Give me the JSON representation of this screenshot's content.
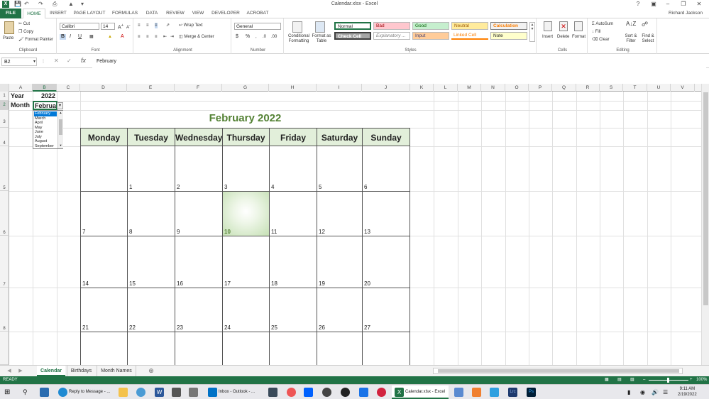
{
  "window": {
    "title": "Calendar.xlsx - Excel",
    "user": "Richard Jackson"
  },
  "colors": {
    "excel_green": "#217346",
    "header_fill": "#e2efda",
    "title_green": "#548235",
    "highlight": "#70ad47"
  },
  "ribbon_tabs": [
    "FILE",
    "HOME",
    "INSERT",
    "PAGE LAYOUT",
    "FORMULAS",
    "DATA",
    "REVIEW",
    "VIEW",
    "DEVELOPER",
    "ACROBAT"
  ],
  "ribbon": {
    "clipboard": {
      "paste": "Paste",
      "cut": "Cut",
      "copy": "Copy",
      "format_painter": "Format Painter",
      "label": "Clipboard"
    },
    "font": {
      "name": "Calibri",
      "size": "14",
      "label": "Font"
    },
    "alignment": {
      "wrap_text": "Wrap Text",
      "merge_center": "Merge & Center",
      "label": "Alignment"
    },
    "number": {
      "format": "General",
      "label": "Number"
    },
    "styles": {
      "conditional": "Conditional Formatting",
      "format_table": "Format as Table",
      "label": "Styles",
      "cells": [
        "Normal",
        "Bad",
        "Good",
        "Neutral",
        "Calculation",
        "Check Cell",
        "Explanatory ...",
        "Input",
        "Linked Cell",
        "Note"
      ]
    },
    "cells": {
      "insert": "Insert",
      "delete": "Delete",
      "format": "Format",
      "label": "Cells"
    },
    "editing": {
      "autosum": "AutoSum",
      "fill": "Fill",
      "clear": "Clear",
      "sort_filter": "Sort & Filter",
      "find_select": "Find & Select",
      "label": "Editing"
    }
  },
  "formula_bar": {
    "name_box": "B2",
    "fx": "fx",
    "value": "February"
  },
  "columns": [
    "A",
    "B",
    "C",
    "D",
    "E",
    "F",
    "G",
    "H",
    "I",
    "J",
    "K",
    "L",
    "M",
    "N",
    "O",
    "P",
    "Q",
    "R",
    "S",
    "T",
    "U",
    "V"
  ],
  "rows": [
    "1",
    "2",
    "3",
    "4",
    "5",
    "6",
    "7",
    "8"
  ],
  "cells": {
    "a1": "Year",
    "b1": "2022",
    "a2": "Month",
    "b2": "Februar"
  },
  "dropdown": [
    "February",
    "March",
    "April",
    "May",
    "June",
    "July",
    "August",
    "September"
  ],
  "calendar": {
    "title": "February   2022",
    "days": [
      "Monday",
      "Tuesday",
      "Wednesday",
      "Thursday",
      "Friday",
      "Saturday",
      "Sunday"
    ],
    "weeks": [
      [
        "",
        "1",
        "2",
        "3",
        "4",
        "5",
        "6"
      ],
      [
        "7",
        "8",
        "9",
        "10",
        "11",
        "12",
        "13"
      ],
      [
        "14",
        "15",
        "16",
        "17",
        "18",
        "19",
        "20"
      ],
      [
        "21",
        "22",
        "23",
        "24",
        "25",
        "26",
        "27"
      ]
    ],
    "today": "10"
  },
  "sheet_tabs": [
    "Calendar",
    "Birthdays",
    "Month Names"
  ],
  "status": {
    "mode": "READY",
    "zoom": "100%"
  },
  "taskbar": {
    "items": [
      "Reply to Message - ...",
      "Inbox - Outlook - ...",
      "Calendar.xlsx - Excel"
    ],
    "time": "9:11 AM",
    "date": "2/19/2022"
  }
}
